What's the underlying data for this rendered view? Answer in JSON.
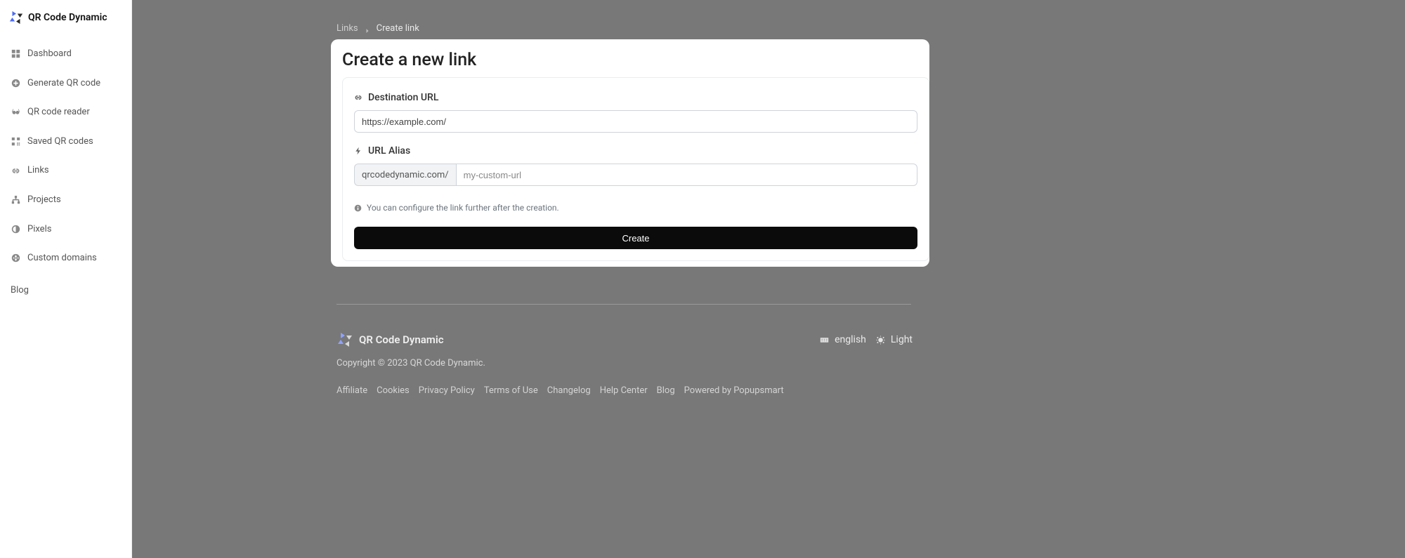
{
  "brand": {
    "name": "QR Code Dynamic"
  },
  "sidebar": {
    "items": [
      {
        "label": "Dashboard"
      },
      {
        "label": "Generate QR code"
      },
      {
        "label": "QR code reader"
      },
      {
        "label": "Saved QR codes"
      },
      {
        "label": "Links"
      },
      {
        "label": "Projects"
      },
      {
        "label": "Pixels"
      },
      {
        "label": "Custom domains"
      }
    ],
    "blog": "Blog"
  },
  "breadcrumb": {
    "links": "Links",
    "current": "Create link"
  },
  "card": {
    "title": "Create a new link",
    "destination_label": "Destination URL",
    "destination_value": "https://example.com/",
    "alias_label": "URL Alias",
    "alias_prefix": "qrcodedynamic.com/",
    "alias_placeholder": "my-custom-url",
    "hint": "You can configure the link further after the creation.",
    "create_button": "Create"
  },
  "footer": {
    "logo_text": "QR Code Dynamic",
    "language": "english",
    "theme": "Light",
    "copyright": "Copyright © 2023 QR Code Dynamic.",
    "links": [
      "Affiliate",
      "Cookies",
      "Privacy Policy",
      "Terms of Use",
      "Changelog",
      "Help Center",
      "Blog",
      "Powered by Popupsmart"
    ]
  }
}
